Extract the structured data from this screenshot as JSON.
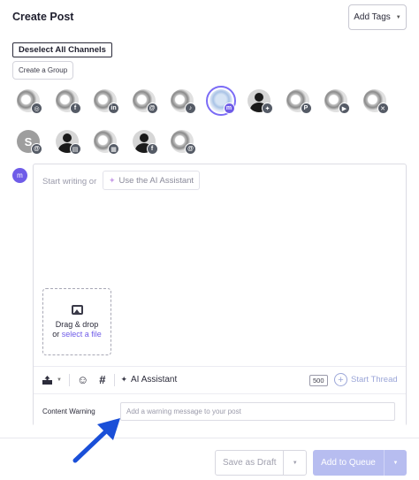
{
  "header": {
    "title": "Create Post",
    "add_tags_label": "Add Tags",
    "add_tags_caret": "▼"
  },
  "channels": {
    "deselect_label": "Deselect All Channels",
    "create_group_label": "Create a Group",
    "row1": [
      {
        "avatar": "photo",
        "badge": "instagram-icon",
        "glyph": "◎"
      },
      {
        "avatar": "photo",
        "badge": "facebook-icon",
        "glyph": "f"
      },
      {
        "avatar": "photo",
        "badge": "linkedin-icon",
        "glyph": "in"
      },
      {
        "avatar": "photo",
        "badge": "threads-icon",
        "glyph": "@"
      },
      {
        "avatar": "photo",
        "badge": "tiktok-icon",
        "glyph": "♪"
      },
      {
        "avatar": "selected",
        "badge": "mastodon-icon",
        "glyph": "m"
      },
      {
        "avatar": "person",
        "badge": "bluesky-icon",
        "glyph": "✦"
      },
      {
        "avatar": "photo",
        "badge": "pinterest-icon",
        "glyph": "P"
      },
      {
        "avatar": "photo",
        "badge": "youtube-icon",
        "glyph": "▶"
      },
      {
        "avatar": "photo",
        "badge": "x-icon",
        "glyph": "✕"
      }
    ],
    "row2": [
      {
        "avatar": "letter",
        "letter": "S",
        "badge": "threads-icon",
        "glyph": "@"
      },
      {
        "avatar": "person",
        "badge": "google-business-icon",
        "glyph": "▤"
      },
      {
        "avatar": "photo",
        "badge": "shop-icon",
        "glyph": "▦"
      },
      {
        "avatar": "person",
        "badge": "facebook-icon",
        "glyph": "f"
      },
      {
        "avatar": "photo",
        "badge": "threads-icon",
        "glyph": "@"
      }
    ]
  },
  "composer": {
    "side_icon_glyph": "m",
    "placeholder": "Start writing or",
    "ai_button_label": "Use the AI Assistant",
    "wand_glyph": "✦",
    "dropzone": {
      "line1": "Drag & drop",
      "line2_prefix": "or ",
      "link": "select a file"
    },
    "toolbar": {
      "ai_assistant_label": "AI Assistant",
      "emoji_glyph": "☺",
      "hashtag_glyph": "#",
      "char_count": "500",
      "start_thread_label": "Start Thread",
      "plus_glyph": "+"
    },
    "content_warning": {
      "label": "Content Warning",
      "placeholder": "Add a warning message to your post"
    }
  },
  "footer": {
    "save_draft_label": "Save as Draft",
    "add_to_queue_label": "Add to Queue",
    "caret": "▼"
  },
  "colors": {
    "accent": "#6f5ce8",
    "queue_button": "#b7bdf0",
    "annotation_arrow": "#1a4fd8"
  }
}
